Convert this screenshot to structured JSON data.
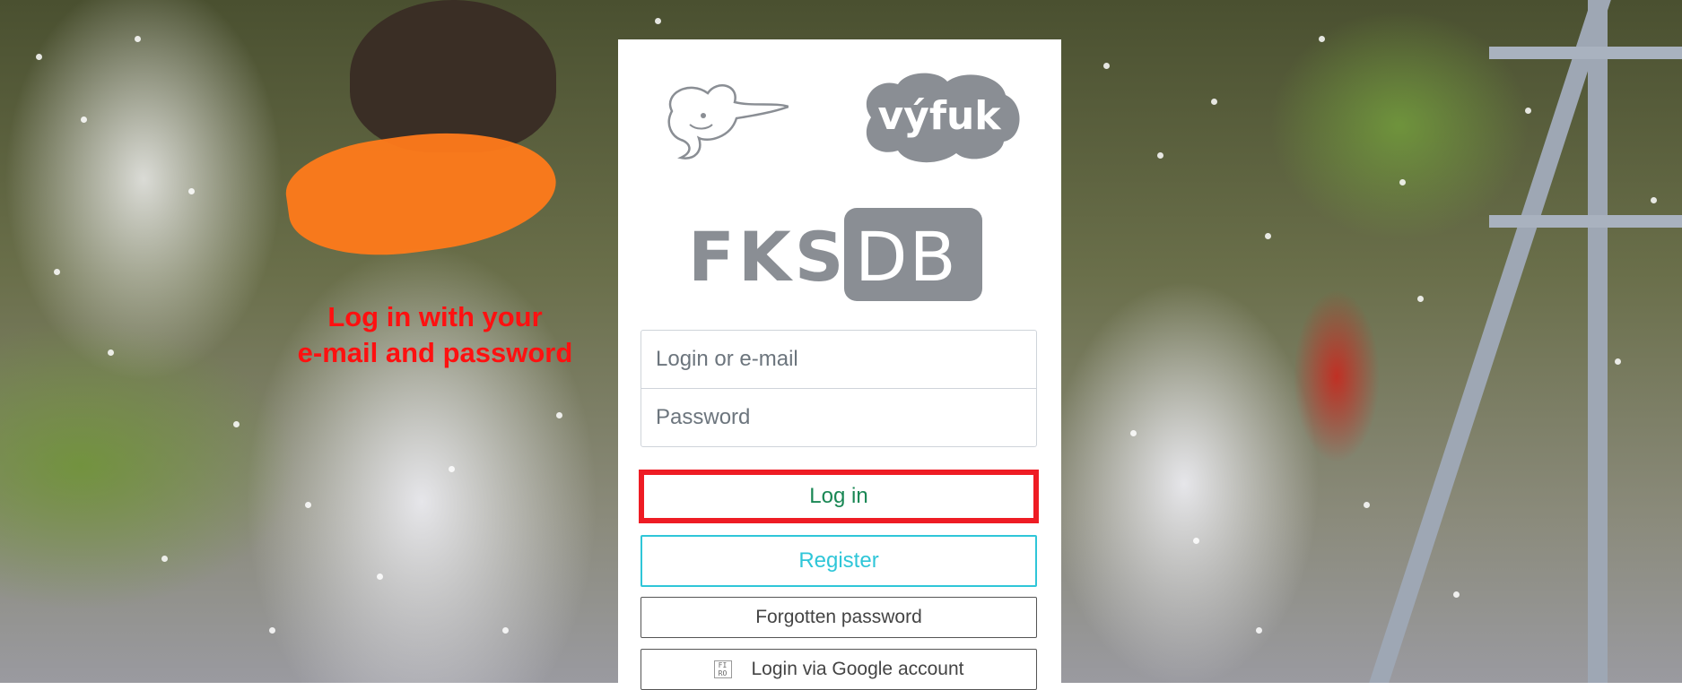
{
  "annotation": {
    "line1": "Log in with your",
    "line2": "e-mail and password"
  },
  "logos": {
    "fks_icon": "fks-squid-logo-icon",
    "vyfuk": "výfuk",
    "fksdb_left": "FKS",
    "fksdb_right": "DB"
  },
  "form": {
    "login_placeholder": "Login or e-mail",
    "password_placeholder": "Password",
    "login_button": "Log in",
    "register_button": "Register",
    "forgotten_button": "Forgotten password",
    "google_button": "Login via Google account",
    "google_icon_text": "FI RO"
  },
  "colors": {
    "annotation": "#ff1010",
    "highlight": "#ee1c24",
    "login_green": "#198754",
    "register_cyan": "#2fc6d8",
    "logo_gray": "#8a8e94"
  }
}
